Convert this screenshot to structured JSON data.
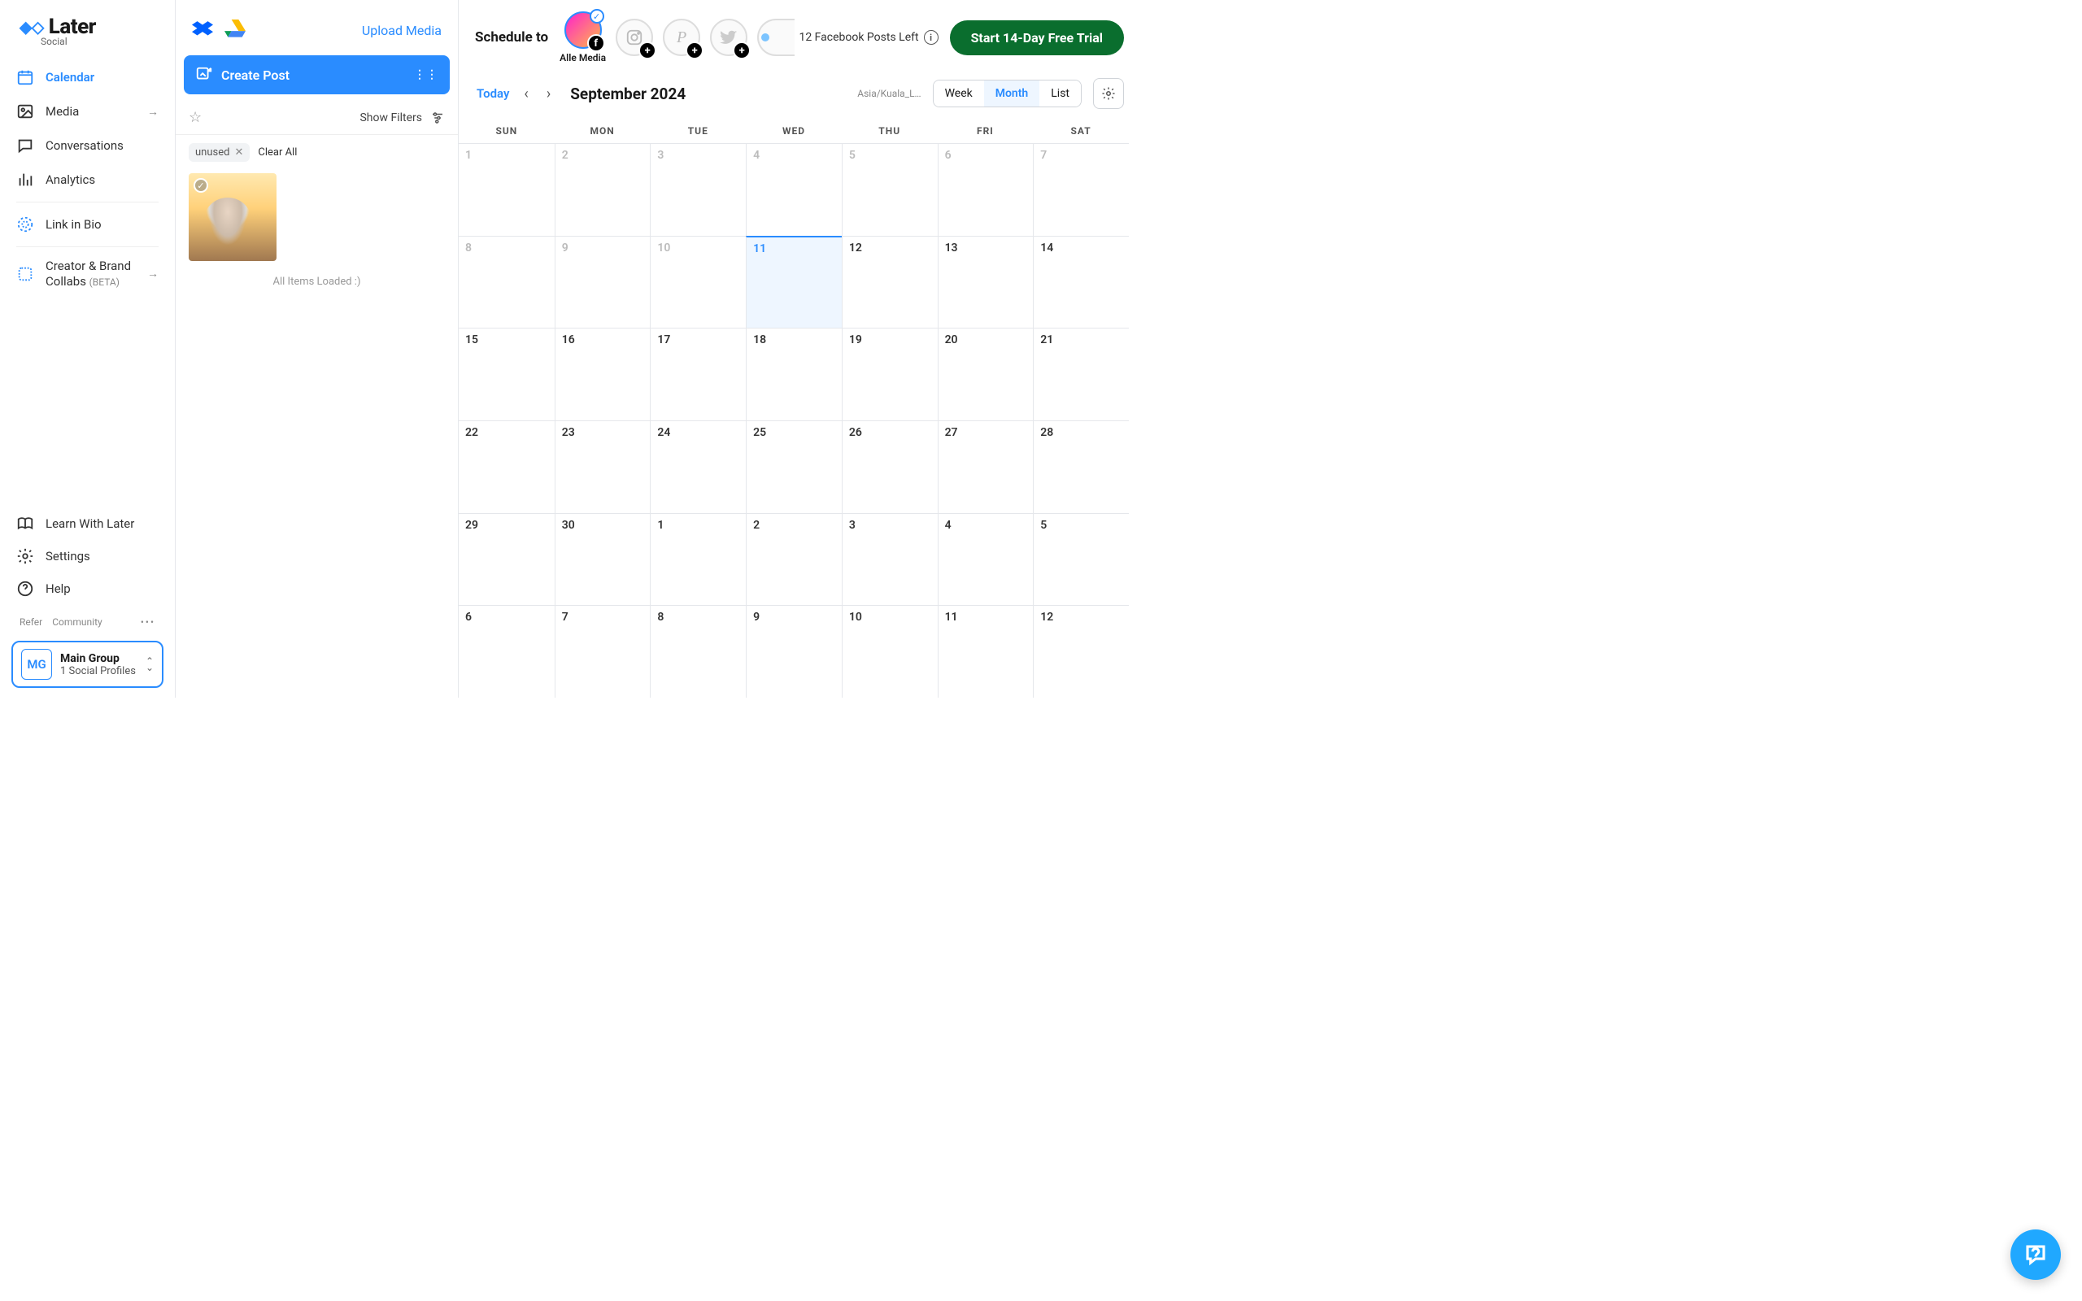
{
  "logo": {
    "brand": "Later",
    "sub": "Social"
  },
  "nav": {
    "calendar": "Calendar",
    "media": "Media",
    "conversations": "Conversations",
    "analytics": "Analytics",
    "linkinbio": "Link in Bio",
    "collabs": "Creator & Brand Collabs",
    "collabs_tag": "(BETA)"
  },
  "bottom_nav": {
    "learn": "Learn With Later",
    "settings": "Settings",
    "help": "Help"
  },
  "footer": {
    "refer": "Refer",
    "community": "Community"
  },
  "group": {
    "badge": "MG",
    "name": "Main Group",
    "sub": "1 Social Profiles"
  },
  "media_col": {
    "upload": "Upload Media",
    "create_post": "Create Post",
    "show_filters": "Show Filters",
    "chip": "unused",
    "clear_all": "Clear All",
    "loaded": "All Items Loaded :)"
  },
  "topbar": {
    "schedule_to": "Schedule to",
    "alle_media": "Alle Media",
    "posts_left": "12 Facebook Posts Left",
    "trial": "Start 14-Day Free Trial"
  },
  "cal": {
    "today": "Today",
    "month_title": "September 2024",
    "tz": "Asia/Kuala_L…",
    "views": {
      "week": "Week",
      "month": "Month",
      "list": "List"
    },
    "dow": [
      "SUN",
      "MON",
      "TUE",
      "WED",
      "THU",
      "FRI",
      "SAT"
    ],
    "days": [
      {
        "n": "1",
        "dim": true
      },
      {
        "n": "2",
        "dim": true
      },
      {
        "n": "3",
        "dim": true
      },
      {
        "n": "4",
        "dim": true
      },
      {
        "n": "5",
        "dim": true
      },
      {
        "n": "6",
        "dim": true
      },
      {
        "n": "7",
        "dim": true
      },
      {
        "n": "8",
        "dim": true
      },
      {
        "n": "9",
        "dim": true
      },
      {
        "n": "10",
        "dim": true
      },
      {
        "n": "11",
        "today": true
      },
      {
        "n": "12"
      },
      {
        "n": "13"
      },
      {
        "n": "14"
      },
      {
        "n": "15"
      },
      {
        "n": "16"
      },
      {
        "n": "17"
      },
      {
        "n": "18"
      },
      {
        "n": "19"
      },
      {
        "n": "20"
      },
      {
        "n": "21"
      },
      {
        "n": "22"
      },
      {
        "n": "23"
      },
      {
        "n": "24"
      },
      {
        "n": "25"
      },
      {
        "n": "26"
      },
      {
        "n": "27"
      },
      {
        "n": "28"
      },
      {
        "n": "29"
      },
      {
        "n": "30"
      },
      {
        "n": "1"
      },
      {
        "n": "2"
      },
      {
        "n": "3"
      },
      {
        "n": "4"
      },
      {
        "n": "5"
      },
      {
        "n": "6"
      },
      {
        "n": "7"
      },
      {
        "n": "8"
      },
      {
        "n": "9"
      },
      {
        "n": "10"
      },
      {
        "n": "11"
      },
      {
        "n": "12"
      }
    ]
  }
}
